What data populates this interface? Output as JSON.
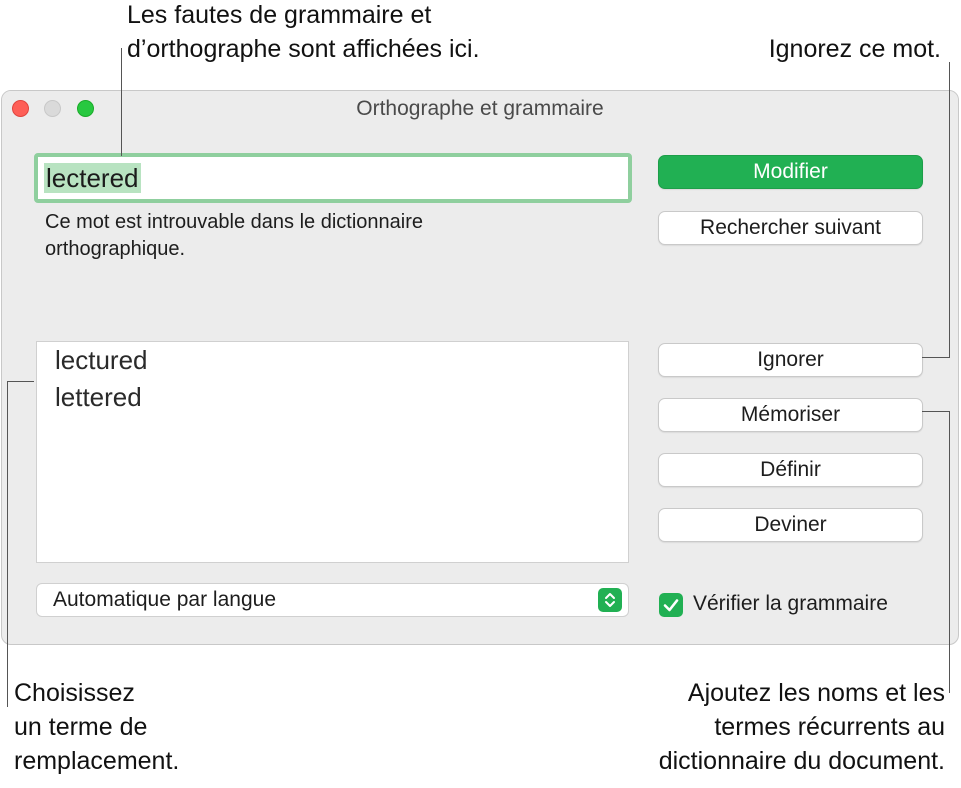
{
  "callouts": {
    "top_left": [
      "Les fautes de grammaire et",
      "d’orthographe sont affichées ici."
    ],
    "top_right": "Ignorez ce mot.",
    "bottom_left": [
      "Choisissez",
      "un terme de",
      "remplacement."
    ],
    "bottom_right": [
      "Ajoutez les noms et les",
      "termes récurrents au",
      "dictionnaire du document."
    ]
  },
  "window": {
    "title": "Orthographe et grammaire",
    "misspelled_word": "lectered",
    "message": [
      "Ce mot est introuvable dans le dictionnaire",
      "orthographique."
    ],
    "buttons": {
      "change": "Modifier",
      "find_next": "Rechercher suivant",
      "ignore": "Ignorer",
      "learn": "Mémoriser",
      "define": "Définir",
      "guess": "Deviner"
    },
    "suggestions": [
      "lectured",
      "lettered"
    ],
    "language": "Automatique par langue",
    "check_grammar": {
      "label": "Vérifier la grammaire",
      "checked": true
    }
  },
  "colors": {
    "accent": "#21b053",
    "field_focus": "#8fcf9e",
    "selection": "#b8e3c1"
  }
}
